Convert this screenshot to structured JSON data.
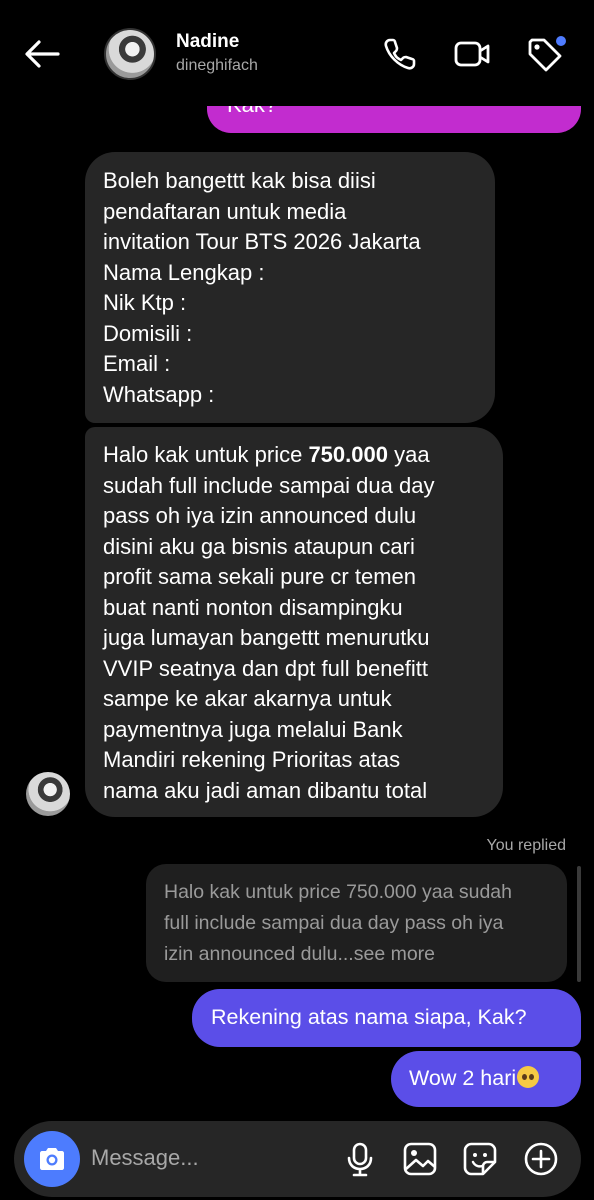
{
  "header": {
    "name": "Nadine",
    "username": "dineghifach",
    "icons": [
      "back-arrow-icon",
      "phone-icon",
      "video-call-icon",
      "tag-icon"
    ],
    "notification_dot_color": "#4f7cff"
  },
  "messages": {
    "top_partial": "Kak?",
    "incoming_1": "Boleh bangettt kak bisa diisi\npendaftaran untuk media\ninvitation Tour BTS 2026 Jakarta\nNama Lengkap :\nNik Ktp :\nDomisili :\nEmail :\nWhatsapp :",
    "incoming_2_prefix": "Halo kak untuk price ",
    "incoming_2_bold": "750.000",
    "incoming_2_rest": " yaa\nsudah full include sampai dua day\npass oh iya izin announced dulu\ndisini aku ga bisnis ataupun cari\nprofit sama sekali pure cr temen\nbuat nanti nonton disampingku\njuga lumayan bangettt menurutku\nVVIP seatnya dan dpt full benefitt\nsampe ke akar akarnya untuk\npaymentnya juga melalui Bank\nMandiri rekening Prioritas atas\nnama aku jadi aman dibantu total",
    "you_replied": "You replied",
    "quoted": "Halo kak untuk price 750.000 yaa sudah\nfull include sampai dua day pass oh iya\nizin announced dulu...see more",
    "outgoing_1": "Rekening atas nama siapa, Kak?",
    "outgoing_2": "Wow 2 hari",
    "outgoing_2_emoji": "pleading-face-emoji"
  },
  "composer": {
    "placeholder": "Message...",
    "icons": [
      "camera-icon",
      "microphone-icon",
      "gallery-icon",
      "sticker-icon",
      "plus-icon"
    ]
  },
  "colors": {
    "outgoing_bubble": "#5b4ee8",
    "incoming_bubble": "#262626",
    "top_bubble": "#c22ccf",
    "camera_button": "#4d7cfe"
  }
}
